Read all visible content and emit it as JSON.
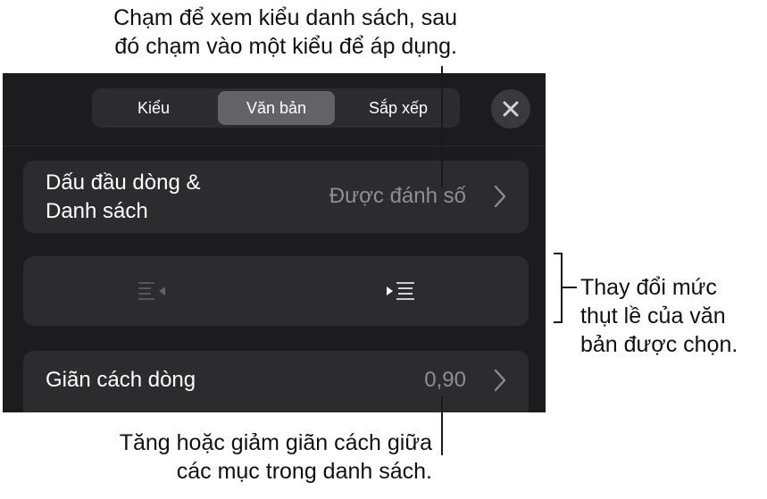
{
  "callouts": {
    "top": [
      "Chạm để xem kiểu danh sách, sau",
      "đó chạm vào một kiểu để áp dụng."
    ],
    "right": [
      "Thay đổi mức",
      "thụt lề của văn",
      "bản được chọn."
    ],
    "bottom": [
      "Tăng hoặc giảm giãn cách giữa",
      "các mục trong danh sách."
    ]
  },
  "tabs": [
    {
      "label": "Kiểu",
      "active": false
    },
    {
      "label": "Văn bản",
      "active": true
    },
    {
      "label": "Sắp xếp",
      "active": false
    }
  ],
  "close": {
    "icon": "close-icon"
  },
  "bullets_row": {
    "label_lines": [
      "Dấu đầu dòng &",
      "Danh sách"
    ],
    "value": "Được đánh số",
    "icon": "chevron-right-icon"
  },
  "indent_row": {
    "decrease": {
      "icon": "decrease-indent-icon",
      "enabled": false
    },
    "increase": {
      "icon": "increase-indent-icon",
      "enabled": true
    }
  },
  "spacing_row": {
    "label": "Giãn cách dòng",
    "value": "0,90",
    "icon": "chevron-right-icon"
  },
  "colors": {
    "panel_bg": "#1c1c1e",
    "row_bg": "#2c2c2e",
    "active_tab": "#636366",
    "secondary_text": "#8e8e93"
  }
}
